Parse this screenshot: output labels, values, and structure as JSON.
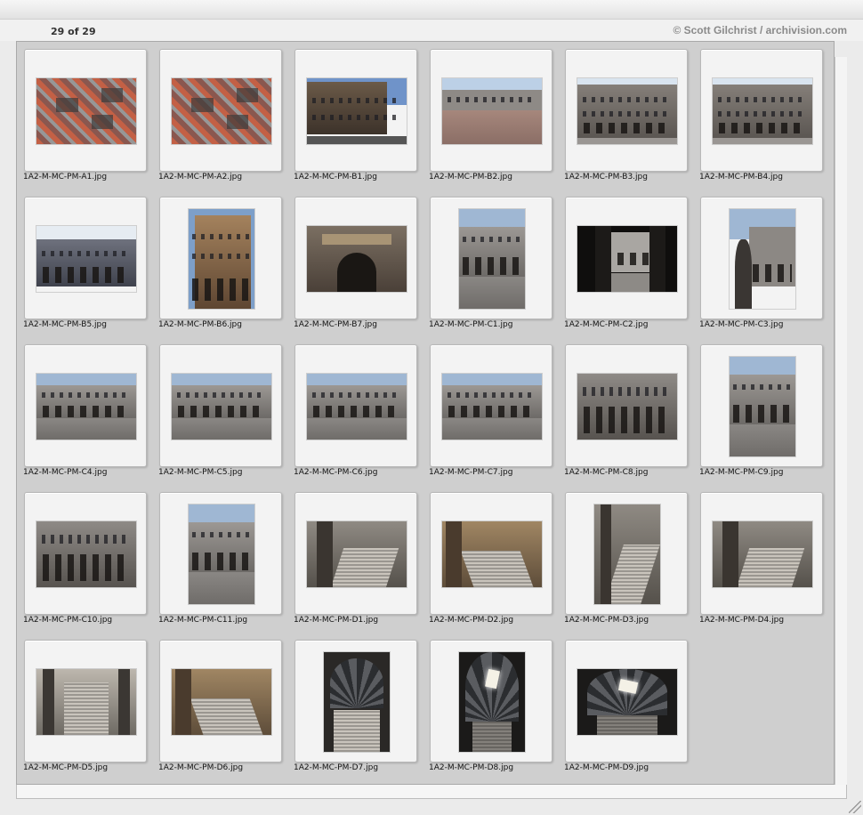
{
  "header": {
    "counter": "29 of 29",
    "credit": "© Scott Gilchrist / archivision.com"
  },
  "thumbnails": [
    {
      "file": "1A2-M-MC-PM-A1.jpg",
      "orientation": "landscape",
      "scene": "aerial"
    },
    {
      "file": "1A2-M-MC-PM-A2.jpg",
      "orientation": "landscape",
      "scene": "aerial"
    },
    {
      "file": "1A2-M-MC-PM-B1.jpg",
      "orientation": "landscape",
      "scene": "street"
    },
    {
      "file": "1A2-M-MC-PM-B2.jpg",
      "orientation": "landscape",
      "scene": "plaza"
    },
    {
      "file": "1A2-M-MC-PM-B3.jpg",
      "orientation": "landscape",
      "scene": "facade"
    },
    {
      "file": "1A2-M-MC-PM-B4.jpg",
      "orientation": "landscape",
      "scene": "facade"
    },
    {
      "file": "1A2-M-MC-PM-B5.jpg",
      "orientation": "landscape",
      "scene": "facade-blue"
    },
    {
      "file": "1A2-M-MC-PM-B6.jpg",
      "orientation": "portrait",
      "scene": "tower"
    },
    {
      "file": "1A2-M-MC-PM-B7.jpg",
      "orientation": "landscape",
      "scene": "portal"
    },
    {
      "file": "1A2-M-MC-PM-C1.jpg",
      "orientation": "portrait",
      "scene": "courtyard"
    },
    {
      "file": "1A2-M-MC-PM-C2.jpg",
      "orientation": "landscape",
      "scene": "arcade-dark"
    },
    {
      "file": "1A2-M-MC-PM-C3.jpg",
      "orientation": "portrait",
      "scene": "courtyard-urn"
    },
    {
      "file": "1A2-M-MC-PM-C4.jpg",
      "orientation": "landscape",
      "scene": "courtyard"
    },
    {
      "file": "1A2-M-MC-PM-C5.jpg",
      "orientation": "landscape",
      "scene": "courtyard"
    },
    {
      "file": "1A2-M-MC-PM-C6.jpg",
      "orientation": "landscape",
      "scene": "courtyard"
    },
    {
      "file": "1A2-M-MC-PM-C7.jpg",
      "orientation": "landscape",
      "scene": "courtyard"
    },
    {
      "file": "1A2-M-MC-PM-C8.jpg",
      "orientation": "landscape",
      "scene": "arcade-close"
    },
    {
      "file": "1A2-M-MC-PM-C9.jpg",
      "orientation": "portrait",
      "scene": "courtyard"
    },
    {
      "file": "1A2-M-MC-PM-C10.jpg",
      "orientation": "landscape",
      "scene": "arcade-close"
    },
    {
      "file": "1A2-M-MC-PM-C11.jpg",
      "orientation": "portrait",
      "scene": "courtyard"
    },
    {
      "file": "1A2-M-MC-PM-D1.jpg",
      "orientation": "landscape",
      "scene": "stairs"
    },
    {
      "file": "1A2-M-MC-PM-D2.jpg",
      "orientation": "landscape",
      "scene": "stairs-warm"
    },
    {
      "file": "1A2-M-MC-PM-D3.jpg",
      "orientation": "portrait",
      "scene": "stairs"
    },
    {
      "file": "1A2-M-MC-PM-D4.jpg",
      "orientation": "landscape",
      "scene": "stairs"
    },
    {
      "file": "1A2-M-MC-PM-D5.jpg",
      "orientation": "landscape",
      "scene": "stairs-front"
    },
    {
      "file": "1A2-M-MC-PM-D6.jpg",
      "orientation": "landscape",
      "scene": "stairs-warm"
    },
    {
      "file": "1A2-M-MC-PM-D7.jpg",
      "orientation": "portrait",
      "scene": "dome"
    },
    {
      "file": "1A2-M-MC-PM-D8.jpg",
      "orientation": "portrait",
      "scene": "dome-skylight"
    },
    {
      "file": "1A2-M-MC-PM-D9.jpg",
      "orientation": "landscape",
      "scene": "dome-skylight"
    }
  ]
}
